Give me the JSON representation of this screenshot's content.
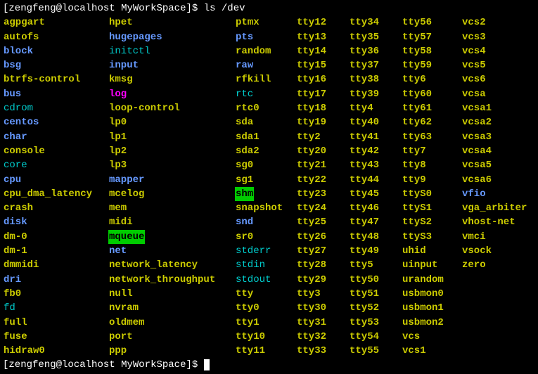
{
  "prompt": {
    "open_bracket": "[",
    "user": "zengfeng",
    "at": "@",
    "host": "localhost",
    "space": " ",
    "dir": "MyWorkSpace",
    "close_bracket": "]",
    "symbol": "$ ",
    "command": "ls /dev"
  },
  "listing": {
    "col1": [
      {
        "name": "agpgart",
        "style": "exec-hl"
      },
      {
        "name": "autofs",
        "style": "exec-hl"
      },
      {
        "name": "block",
        "style": "blue"
      },
      {
        "name": "bsg",
        "style": "blue"
      },
      {
        "name": "btrfs-control",
        "style": "exec-hl"
      },
      {
        "name": "bus",
        "style": "blue"
      },
      {
        "name": "cdrom",
        "style": "link-cyan"
      },
      {
        "name": "centos",
        "style": "blue"
      },
      {
        "name": "char",
        "style": "blue"
      },
      {
        "name": "console",
        "style": "exec-hl"
      },
      {
        "name": "core",
        "style": "link-cyan"
      },
      {
        "name": "cpu",
        "style": "blue"
      },
      {
        "name": "cpu_dma_latency",
        "style": "exec-hl"
      },
      {
        "name": "crash",
        "style": "exec-hl"
      },
      {
        "name": "disk",
        "style": "blue"
      },
      {
        "name": "dm-0",
        "style": "exec-hl"
      },
      {
        "name": "dm-1",
        "style": "exec-hl"
      },
      {
        "name": "dmmidi",
        "style": "exec-hl"
      },
      {
        "name": "dri",
        "style": "blue"
      },
      {
        "name": "fb0",
        "style": "exec-hl"
      },
      {
        "name": "fd",
        "style": "link-cyan"
      },
      {
        "name": "full",
        "style": "exec-hl"
      },
      {
        "name": "fuse",
        "style": "exec-hl"
      },
      {
        "name": "hidraw0",
        "style": "exec-hl"
      }
    ],
    "col2": [
      {
        "name": "hpet",
        "style": "exec-hl"
      },
      {
        "name": "hugepages",
        "style": "blue"
      },
      {
        "name": "initctl",
        "style": "link-cyan"
      },
      {
        "name": "input",
        "style": "blue"
      },
      {
        "name": "kmsg",
        "style": "exec-hl"
      },
      {
        "name": "log",
        "style": "magenta"
      },
      {
        "name": "loop-control",
        "style": "exec-hl"
      },
      {
        "name": "lp0",
        "style": "exec-hl"
      },
      {
        "name": "lp1",
        "style": "exec-hl"
      },
      {
        "name": "lp2",
        "style": "exec-hl"
      },
      {
        "name": "lp3",
        "style": "exec-hl"
      },
      {
        "name": "mapper",
        "style": "blue"
      },
      {
        "name": "mcelog",
        "style": "exec-hl"
      },
      {
        "name": "mem",
        "style": "exec-hl"
      },
      {
        "name": "midi",
        "style": "exec-hl"
      },
      {
        "name": "mqueue",
        "style": "green-hl"
      },
      {
        "name": "net",
        "style": "blue"
      },
      {
        "name": "network_latency",
        "style": "exec-hl"
      },
      {
        "name": "network_throughput",
        "style": "exec-hl"
      },
      {
        "name": "null",
        "style": "exec-hl"
      },
      {
        "name": "nvram",
        "style": "exec-hl"
      },
      {
        "name": "oldmem",
        "style": "exec-hl"
      },
      {
        "name": "port",
        "style": "exec-hl"
      },
      {
        "name": "ppp",
        "style": "exec-hl"
      }
    ],
    "col3": [
      {
        "name": "ptmx",
        "style": "exec-hl"
      },
      {
        "name": "pts",
        "style": "blue"
      },
      {
        "name": "random",
        "style": "exec-hl"
      },
      {
        "name": "raw",
        "style": "blue"
      },
      {
        "name": "rfkill",
        "style": "exec-hl"
      },
      {
        "name": "rtc",
        "style": "link-cyan"
      },
      {
        "name": "rtc0",
        "style": "exec-hl"
      },
      {
        "name": "sda",
        "style": "exec-hl"
      },
      {
        "name": "sda1",
        "style": "exec-hl"
      },
      {
        "name": "sda2",
        "style": "exec-hl"
      },
      {
        "name": "sg0",
        "style": "exec-hl"
      },
      {
        "name": "sg1",
        "style": "exec-hl"
      },
      {
        "name": "shm",
        "style": "green-hl"
      },
      {
        "name": "snapshot",
        "style": "exec-hl"
      },
      {
        "name": "snd",
        "style": "blue"
      },
      {
        "name": "sr0",
        "style": "exec-hl"
      },
      {
        "name": "stderr",
        "style": "link-cyan"
      },
      {
        "name": "stdin",
        "style": "link-cyan"
      },
      {
        "name": "stdout",
        "style": "link-cyan"
      },
      {
        "name": "tty",
        "style": "exec-hl"
      },
      {
        "name": "tty0",
        "style": "exec-hl"
      },
      {
        "name": "tty1",
        "style": "exec-hl"
      },
      {
        "name": "tty10",
        "style": "exec-hl"
      },
      {
        "name": "tty11",
        "style": "exec-hl"
      }
    ],
    "col4": [
      {
        "name": "tty12",
        "style": "exec-hl"
      },
      {
        "name": "tty13",
        "style": "exec-hl"
      },
      {
        "name": "tty14",
        "style": "exec-hl"
      },
      {
        "name": "tty15",
        "style": "exec-hl"
      },
      {
        "name": "tty16",
        "style": "exec-hl"
      },
      {
        "name": "tty17",
        "style": "exec-hl"
      },
      {
        "name": "tty18",
        "style": "exec-hl"
      },
      {
        "name": "tty19",
        "style": "exec-hl"
      },
      {
        "name": "tty2",
        "style": "exec-hl"
      },
      {
        "name": "tty20",
        "style": "exec-hl"
      },
      {
        "name": "tty21",
        "style": "exec-hl"
      },
      {
        "name": "tty22",
        "style": "exec-hl"
      },
      {
        "name": "tty23",
        "style": "exec-hl"
      },
      {
        "name": "tty24",
        "style": "exec-hl"
      },
      {
        "name": "tty25",
        "style": "exec-hl"
      },
      {
        "name": "tty26",
        "style": "exec-hl"
      },
      {
        "name": "tty27",
        "style": "exec-hl"
      },
      {
        "name": "tty28",
        "style": "exec-hl"
      },
      {
        "name": "tty29",
        "style": "exec-hl"
      },
      {
        "name": "tty3",
        "style": "exec-hl"
      },
      {
        "name": "tty30",
        "style": "exec-hl"
      },
      {
        "name": "tty31",
        "style": "exec-hl"
      },
      {
        "name": "tty32",
        "style": "exec-hl"
      },
      {
        "name": "tty33",
        "style": "exec-hl"
      }
    ],
    "col5": [
      {
        "name": "tty34",
        "style": "exec-hl"
      },
      {
        "name": "tty35",
        "style": "exec-hl"
      },
      {
        "name": "tty36",
        "style": "exec-hl"
      },
      {
        "name": "tty37",
        "style": "exec-hl"
      },
      {
        "name": "tty38",
        "style": "exec-hl"
      },
      {
        "name": "tty39",
        "style": "exec-hl"
      },
      {
        "name": "tty4",
        "style": "exec-hl"
      },
      {
        "name": "tty40",
        "style": "exec-hl"
      },
      {
        "name": "tty41",
        "style": "exec-hl"
      },
      {
        "name": "tty42",
        "style": "exec-hl"
      },
      {
        "name": "tty43",
        "style": "exec-hl"
      },
      {
        "name": "tty44",
        "style": "exec-hl"
      },
      {
        "name": "tty45",
        "style": "exec-hl"
      },
      {
        "name": "tty46",
        "style": "exec-hl"
      },
      {
        "name": "tty47",
        "style": "exec-hl"
      },
      {
        "name": "tty48",
        "style": "exec-hl"
      },
      {
        "name": "tty49",
        "style": "exec-hl"
      },
      {
        "name": "tty5",
        "style": "exec-hl"
      },
      {
        "name": "tty50",
        "style": "exec-hl"
      },
      {
        "name": "tty51",
        "style": "exec-hl"
      },
      {
        "name": "tty52",
        "style": "exec-hl"
      },
      {
        "name": "tty53",
        "style": "exec-hl"
      },
      {
        "name": "tty54",
        "style": "exec-hl"
      },
      {
        "name": "tty55",
        "style": "exec-hl"
      }
    ],
    "col6": [
      {
        "name": "tty56",
        "style": "exec-hl"
      },
      {
        "name": "tty57",
        "style": "exec-hl"
      },
      {
        "name": "tty58",
        "style": "exec-hl"
      },
      {
        "name": "tty59",
        "style": "exec-hl"
      },
      {
        "name": "tty6",
        "style": "exec-hl"
      },
      {
        "name": "tty60",
        "style": "exec-hl"
      },
      {
        "name": "tty61",
        "style": "exec-hl"
      },
      {
        "name": "tty62",
        "style": "exec-hl"
      },
      {
        "name": "tty63",
        "style": "exec-hl"
      },
      {
        "name": "tty7",
        "style": "exec-hl"
      },
      {
        "name": "tty8",
        "style": "exec-hl"
      },
      {
        "name": "tty9",
        "style": "exec-hl"
      },
      {
        "name": "ttyS0",
        "style": "exec-hl"
      },
      {
        "name": "ttyS1",
        "style": "exec-hl"
      },
      {
        "name": "ttyS2",
        "style": "exec-hl"
      },
      {
        "name": "ttyS3",
        "style": "exec-hl"
      },
      {
        "name": "uhid",
        "style": "exec-hl"
      },
      {
        "name": "uinput",
        "style": "exec-hl"
      },
      {
        "name": "urandom",
        "style": "exec-hl"
      },
      {
        "name": "usbmon0",
        "style": "exec-hl"
      },
      {
        "name": "usbmon1",
        "style": "exec-hl"
      },
      {
        "name": "usbmon2",
        "style": "exec-hl"
      },
      {
        "name": "vcs",
        "style": "exec-hl"
      },
      {
        "name": "vcs1",
        "style": "exec-hl"
      }
    ],
    "col7": [
      {
        "name": "vcs2",
        "style": "exec-hl"
      },
      {
        "name": "vcs3",
        "style": "exec-hl"
      },
      {
        "name": "vcs4",
        "style": "exec-hl"
      },
      {
        "name": "vcs5",
        "style": "exec-hl"
      },
      {
        "name": "vcs6",
        "style": "exec-hl"
      },
      {
        "name": "vcsa",
        "style": "exec-hl"
      },
      {
        "name": "vcsa1",
        "style": "exec-hl"
      },
      {
        "name": "vcsa2",
        "style": "exec-hl"
      },
      {
        "name": "vcsa3",
        "style": "exec-hl"
      },
      {
        "name": "vcsa4",
        "style": "exec-hl"
      },
      {
        "name": "vcsa5",
        "style": "exec-hl"
      },
      {
        "name": "vcsa6",
        "style": "exec-hl"
      },
      {
        "name": "vfio",
        "style": "blue"
      },
      {
        "name": "vga_arbiter",
        "style": "exec-hl"
      },
      {
        "name": "vhost-net",
        "style": "exec-hl"
      },
      {
        "name": "vmci",
        "style": "exec-hl"
      },
      {
        "name": "vsock",
        "style": "exec-hl"
      },
      {
        "name": "zero",
        "style": "exec-hl"
      }
    ]
  }
}
